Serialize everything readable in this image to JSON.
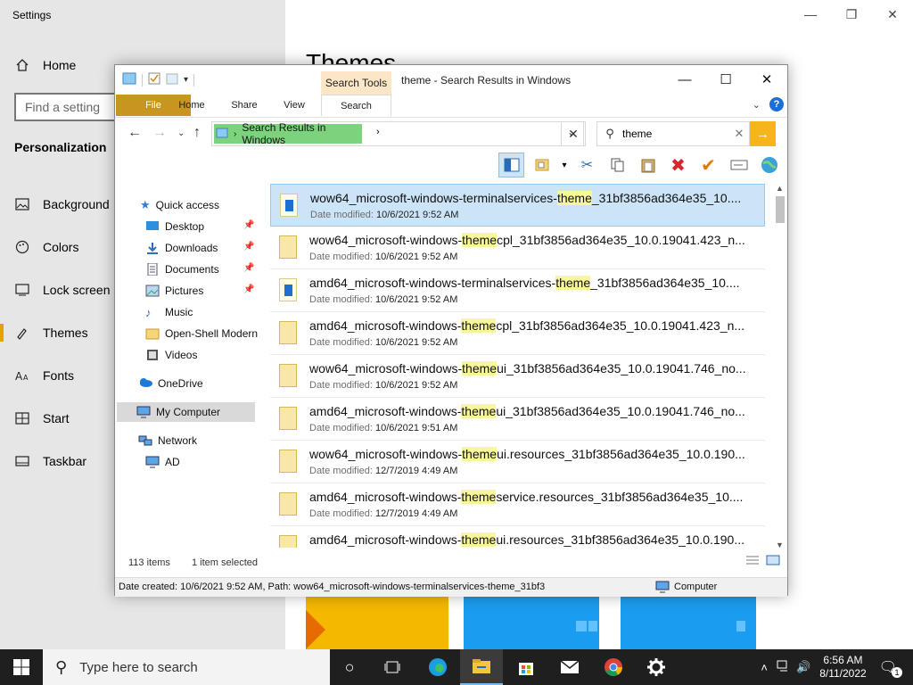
{
  "settings": {
    "title": "Settings",
    "home": "Home",
    "search_placeholder": "Find a setting",
    "section": "Personalization",
    "main_title": "Themes",
    "nav": [
      {
        "label": "Background",
        "icon": "picture-icon"
      },
      {
        "label": "Colors",
        "icon": "palette-icon"
      },
      {
        "label": "Lock screen",
        "icon": "lock-screen-icon"
      },
      {
        "label": "Themes",
        "icon": "brush-icon",
        "active": true
      },
      {
        "label": "Fonts",
        "icon": "fonts-icon"
      },
      {
        "label": "Start",
        "icon": "start-icon"
      },
      {
        "label": "Taskbar",
        "icon": "taskbar-icon"
      }
    ]
  },
  "explorer": {
    "title": "theme - Search Results in Windows",
    "contextual_tab": "Search Tools",
    "tabs": [
      "File",
      "Home",
      "Share",
      "View",
      "Search"
    ],
    "breadcrumb": "Search Results in Windows",
    "search_value": "theme",
    "nav_pane": {
      "quick_access": "Quick access",
      "items": [
        {
          "label": "Desktop",
          "pinned": true
        },
        {
          "label": "Downloads",
          "pinned": true
        },
        {
          "label": "Documents",
          "pinned": true
        },
        {
          "label": "Pictures",
          "pinned": true
        },
        {
          "label": "Music",
          "pinned": false
        },
        {
          "label": "Open-Shell Modern",
          "pinned": false
        },
        {
          "label": "Videos",
          "pinned": false
        }
      ],
      "onedrive": "OneDrive",
      "my_computer": "My Computer",
      "network": "Network",
      "network_child": "AD"
    },
    "results": [
      {
        "pre": "wow64_microsoft-windows-terminalservices-",
        "hl": "theme",
        "post": "_31bf3856ad364e35_10....",
        "date": "10/6/2021 9:52 AM",
        "selected": true,
        "icon": "dll"
      },
      {
        "pre": "wow64_microsoft-windows-",
        "hl": "theme",
        "post": "cpl_31bf3856ad364e35_10.0.19041.423_n...",
        "date": "10/6/2021 9:52 AM",
        "selected": false,
        "icon": "folder"
      },
      {
        "pre": "amd64_microsoft-windows-terminalservices-",
        "hl": "theme",
        "post": "_31bf3856ad364e35_10....",
        "date": "10/6/2021 9:52 AM",
        "selected": false,
        "icon": "dll"
      },
      {
        "pre": "amd64_microsoft-windows-",
        "hl": "theme",
        "post": "cpl_31bf3856ad364e35_10.0.19041.423_n...",
        "date": "10/6/2021 9:52 AM",
        "selected": false,
        "icon": "folder"
      },
      {
        "pre": "wow64_microsoft-windows-",
        "hl": "theme",
        "post": "ui_31bf3856ad364e35_10.0.19041.746_no...",
        "date": "10/6/2021 9:52 AM",
        "selected": false,
        "icon": "folder"
      },
      {
        "pre": "amd64_microsoft-windows-",
        "hl": "theme",
        "post": "ui_31bf3856ad364e35_10.0.19041.746_no...",
        "date": "10/6/2021 9:51 AM",
        "selected": false,
        "icon": "folder"
      },
      {
        "pre": "wow64_microsoft-windows-",
        "hl": "theme",
        "post": "ui.resources_31bf3856ad364e35_10.0.190...",
        "date": "12/7/2019 4:49 AM",
        "selected": false,
        "icon": "folder"
      },
      {
        "pre": "amd64_microsoft-windows-",
        "hl": "theme",
        "post": "service.resources_31bf3856ad364e35_10....",
        "date": "12/7/2019 4:49 AM",
        "selected": false,
        "icon": "folder"
      },
      {
        "pre": "amd64_microsoft-windows-",
        "hl": "theme",
        "post": "ui.resources_31bf3856ad364e35_10.0.190...",
        "date": "",
        "selected": false,
        "icon": "folder"
      }
    ],
    "date_label": "Date modified:",
    "item_count": "113 items",
    "selection": "1 item selected",
    "details": "Date created: 10/6/2021 9:52 AM, Path: wow64_microsoft-windows-terminalservices-theme_31bf3",
    "details_location": "Computer"
  },
  "taskbar": {
    "search_placeholder": "Type here to search",
    "time": "6:56 AM",
    "date": "8/11/2022",
    "notification_count": "1"
  }
}
